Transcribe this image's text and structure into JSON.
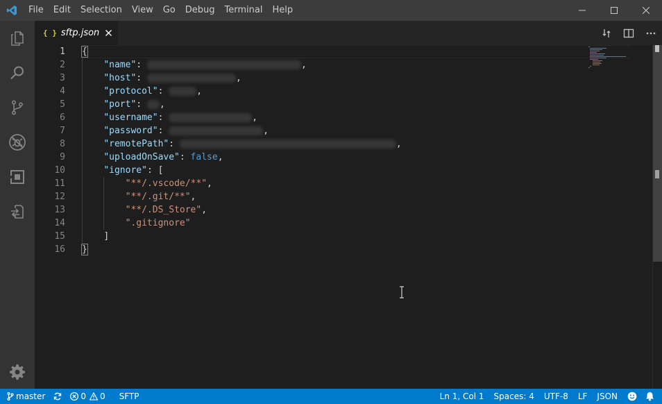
{
  "menu": [
    "File",
    "Edit",
    "Selection",
    "View",
    "Go",
    "Debug",
    "Terminal",
    "Help"
  ],
  "tab": {
    "title": "sftp.json",
    "icon": "{ }"
  },
  "editor": {
    "line_numbers": [
      "1",
      "2",
      "3",
      "4",
      "5",
      "6",
      "7",
      "8",
      "9",
      "10",
      "11",
      "12",
      "13",
      "14",
      "15",
      "16"
    ],
    "active_line": 1,
    "code": {
      "open_brace": "{",
      "close_brace": "}",
      "keys": {
        "name": "\"name\"",
        "host": "\"host\"",
        "protocol": "\"protocol\"",
        "port": "\"port\"",
        "username": "\"username\"",
        "password": "\"password\"",
        "remotePath": "\"remotePath\"",
        "uploadOnSave": "\"uploadOnSave\"",
        "ignore": "\"ignore\""
      },
      "upload_on_save_value": "false",
      "ignore_open": "[",
      "ignore_close": "]",
      "ignore_items": [
        "\"**/.vscode/**\"",
        "\"**/.git/**\"",
        "\"**/.DS_Store\"",
        "\".gitignore\""
      ],
      "colon": ":",
      "comma": ","
    }
  },
  "status": {
    "branch": "master",
    "errors": "0",
    "warnings": "0",
    "sftp": "SFTP",
    "position": "Ln 1, Col 1",
    "spaces": "Spaces: 4",
    "encoding": "UTF-8",
    "eol": "LF",
    "language": "JSON"
  },
  "colors": {
    "accent": "#007acc",
    "key": "#9cdcfe",
    "string": "#ce9178",
    "keyword": "#569cd6",
    "logo": "#3c99d4"
  },
  "icons": {
    "logo": "vscode-logo-icon",
    "explorer": "files-icon",
    "search": "search-icon",
    "scm": "source-control-icon",
    "debug": "debug-icon",
    "extensions": "extensions-icon",
    "remote": "remote-explorer-icon",
    "settings": "gear-icon"
  }
}
